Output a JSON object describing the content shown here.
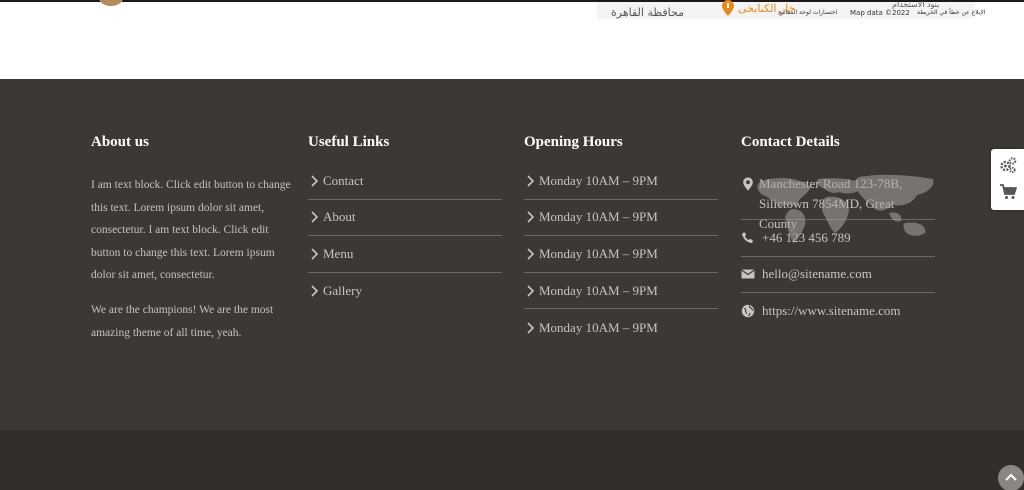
{
  "map": {
    "city_label": "محافظة القاهرة",
    "place_label": "خار الكنابخى",
    "shortcuts_label": "اختصارات لوحة المفاتيح",
    "map_data_label": "Map data ©2022",
    "terms_label": "بنود الاستخدام",
    "report_label": "الإبلاغ عن خطأ في الخريطة",
    "pin_color": "#e68a1e"
  },
  "footer": {
    "about": {
      "heading": "About us",
      "paragraph1": "I am text block. Click edit button to change this text. Lorem ipsum dolor sit amet, consectetur. I am text block. Click edit button to change this text. Lorem ipsum dolor sit amet, consectetur.",
      "paragraph2": "We are the champions! We are the most amazing theme of all time, yeah."
    },
    "links": {
      "heading": "Useful Links",
      "items": [
        {
          "label": "Contact"
        },
        {
          "label": "About"
        },
        {
          "label": "Menu"
        },
        {
          "label": "Gallery"
        }
      ]
    },
    "hours": {
      "heading": "Opening Hours",
      "items": [
        {
          "label": "Monday 10AM – 9PM"
        },
        {
          "label": "Monday 10AM – 9PM"
        },
        {
          "label": "Monday 10AM – 9PM"
        },
        {
          "label": "Monday 10AM – 9PM"
        },
        {
          "label": "Monday 10AM – 9PM"
        }
      ]
    },
    "contact": {
      "heading": "Contact Details",
      "address": "Manchester Road 123-78B, Silictown 7854MD, Great County",
      "phone": "+46 123 456 789",
      "email": "hello@sitename.com",
      "website": "https://www.sitename.com"
    }
  },
  "colors": {
    "footer_bg": "#3b3835",
    "bottom_bg": "#312e2c",
    "heading": "#ffffff",
    "text": "#c9c5c0"
  }
}
